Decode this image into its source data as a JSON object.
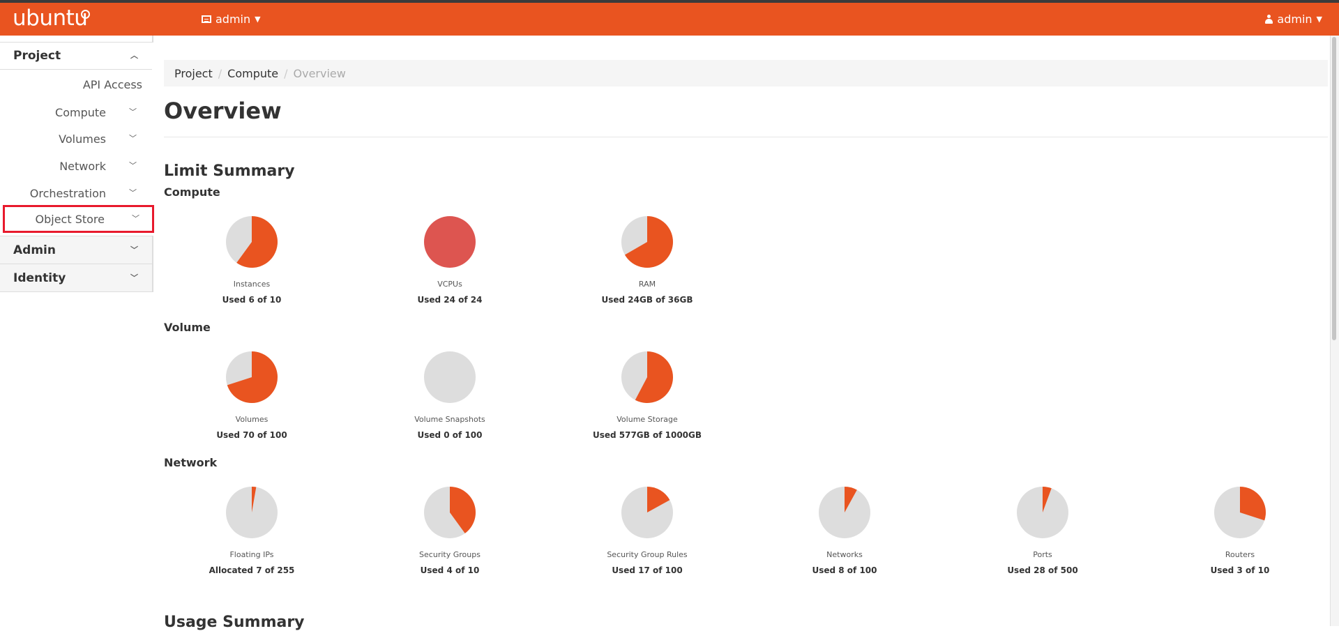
{
  "brand": "ubuntu",
  "navbar": {
    "project_menu": "admin",
    "user_menu": "admin"
  },
  "sidebar": {
    "groups": {
      "project": "Project",
      "admin": "Admin",
      "identity": "Identity"
    },
    "items": [
      {
        "label": "API Access"
      },
      {
        "label": "Compute"
      },
      {
        "label": "Volumes"
      },
      {
        "label": "Network"
      },
      {
        "label": "Orchestration"
      },
      {
        "label": "Object Store"
      }
    ]
  },
  "breadcrumb": [
    "Project",
    "Compute",
    "Overview"
  ],
  "page_title": "Overview",
  "limit_summary": {
    "title": "Limit Summary",
    "sections": [
      {
        "title": "Compute",
        "items": [
          {
            "label": "Instances",
            "used_text": "Used 6 of 10",
            "used": 6,
            "total": 10
          },
          {
            "label": "VCPUs",
            "used_text": "Used 24 of 24",
            "used": 24,
            "total": 24
          },
          {
            "label": "RAM",
            "used_text": "Used 24GB of 36GB",
            "used": 24,
            "total": 36
          }
        ]
      },
      {
        "title": "Volume",
        "items": [
          {
            "label": "Volumes",
            "used_text": "Used 70 of 100",
            "used": 70,
            "total": 100
          },
          {
            "label": "Volume Snapshots",
            "used_text": "Used 0 of 100",
            "used": 0,
            "total": 100
          },
          {
            "label": "Volume Storage",
            "used_text": "Used 577GB of 1000GB",
            "used": 577,
            "total": 1000
          }
        ]
      },
      {
        "title": "Network",
        "items": [
          {
            "label": "Floating IPs",
            "used_text": "Allocated 7 of 255",
            "used": 7,
            "total": 255
          },
          {
            "label": "Security Groups",
            "used_text": "Used 4 of 10",
            "used": 4,
            "total": 10
          },
          {
            "label": "Security Group Rules",
            "used_text": "Used 17 of 100",
            "used": 17,
            "total": 100
          },
          {
            "label": "Networks",
            "used_text": "Used 8 of 100",
            "used": 8,
            "total": 100
          },
          {
            "label": "Ports",
            "used_text": "Used 28 of 500",
            "used": 28,
            "total": 500
          },
          {
            "label": "Routers",
            "used_text": "Used 3 of 10",
            "used": 3,
            "total": 10
          }
        ]
      }
    ]
  },
  "usage_summary_title": "Usage Summary",
  "colors": {
    "accent": "#e95420",
    "full": "#dd5550",
    "empty": "#dddddd"
  }
}
